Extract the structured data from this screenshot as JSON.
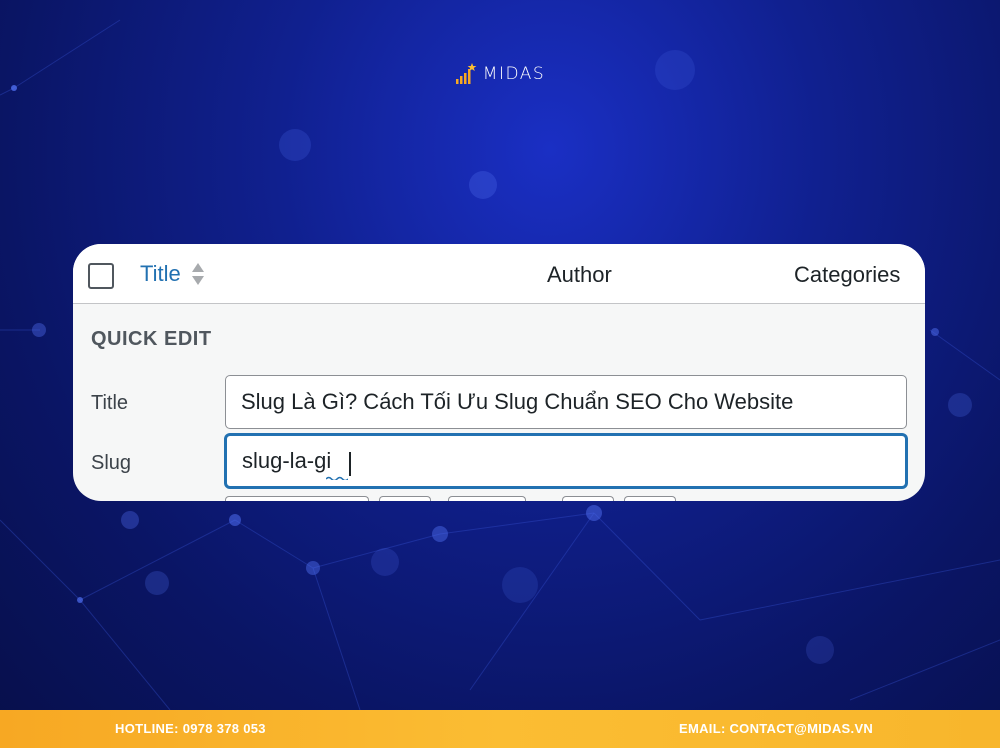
{
  "brand": {
    "name": "MIDAS",
    "accent": "#f7a823"
  },
  "list_header": {
    "checkbox_checked": false,
    "title_column": "Title",
    "author_column": "Author",
    "categories_column": "Categories"
  },
  "quick_edit": {
    "heading": "QUICK EDIT",
    "title_label": "Title",
    "title_value": "Slug Là Gì? Cách Tối Ưu Slug Chuẩn SEO Cho Website",
    "slug_label": "Slug",
    "slug_value": "slug-la-gi"
  },
  "footer": {
    "hotline": "HOTLINE: 0978 378 053",
    "email": "EMAIL: CONTACT@MIDAS.VN"
  },
  "colors": {
    "link_blue": "#2271b1",
    "background_navy": "#10208f",
    "footer_yellow": "#fbbd33"
  }
}
